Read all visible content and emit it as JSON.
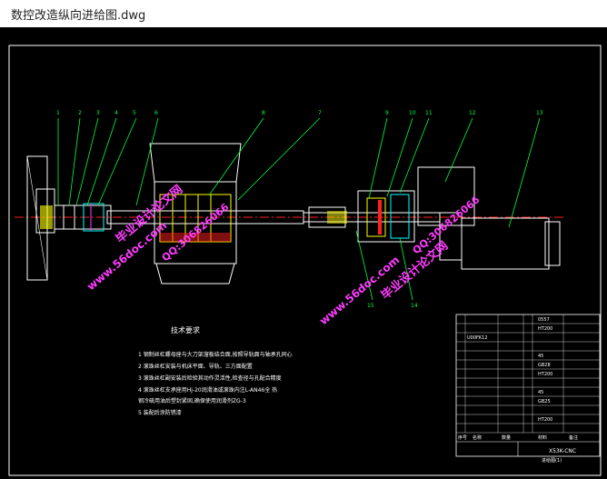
{
  "window": {
    "title": "数控改造纵向进给图.dwg"
  },
  "drawing": {
    "part_numbers": [
      "1",
      "2",
      "3",
      "4",
      "5",
      "6",
      "8",
      "7",
      "9",
      "10",
      "11",
      "12",
      "13",
      "15",
      "14"
    ],
    "tech_title": "技术要求",
    "tech_notes": [
      "1  钢制丝杠螺母座与大刀架溜板结合面,按照导轨面与轴承孔同心",
      "2  滚珠丝杠安装与机床平面、导轨、三方面配置",
      "3  滚珠丝杠副安装后检验其动作灵活性,检查径与孔配合精度",
      "4  滚珠丝杠支承座用Hj-20润滑油或滚珠内注L-AN46全    热",
      "   钢冷硫用油后塑封紧固,确保使用润滑剂ZG-3",
      "5  装配后涂防锈漆"
    ],
    "table": {
      "rows": [
        {
          "c2": "",
          "c3": "",
          "c4": "",
          "c5": "0557"
        },
        {
          "c2": "",
          "c3": "",
          "c4": "",
          "c5": "HT200"
        },
        {
          "c2": "U00FK12",
          "c3": "",
          "c4": "",
          "c5": ""
        },
        {
          "c2": "",
          "c3": "",
          "c4": "",
          "c5": ""
        },
        {
          "c2": "",
          "c3": "",
          "c4": "",
          "c5": "45"
        },
        {
          "c2": "",
          "c3": "",
          "c4": "",
          "c5": "GB28"
        },
        {
          "c2": "",
          "c3": "",
          "c4": "",
          "c5": "HT200"
        },
        {
          "c2": "",
          "c3": "",
          "c4": "",
          "c5": ""
        },
        {
          "c2": "",
          "c3": "",
          "c4": "",
          "c5": "45"
        },
        {
          "c2": "",
          "c3": "",
          "c4": "",
          "c5": "GB25"
        },
        {
          "c2": "",
          "c3": "",
          "c4": "",
          "c5": ""
        },
        {
          "c2": "",
          "c3": "",
          "c4": "",
          "c5": "HT200"
        },
        {
          "c2": "",
          "c3": "",
          "c4": "",
          "c5": ""
        }
      ],
      "header": [
        "序号",
        "名称",
        "数量",
        "材料",
        "备注"
      ]
    },
    "title_block": {
      "code": "X53K-CNC",
      "sub": "进给图(1)"
    },
    "watermarks": [
      "毕业设计论文网",
      "www.56doc.com",
      "QQ:306826066"
    ],
    "colors": {
      "green": "#00ff3c",
      "white": "#ffffff",
      "cyan": "#00ffff",
      "yellow": "#ffff00",
      "red": "#ff2020",
      "magenta": "#ff3cff",
      "background": "#000000"
    }
  }
}
